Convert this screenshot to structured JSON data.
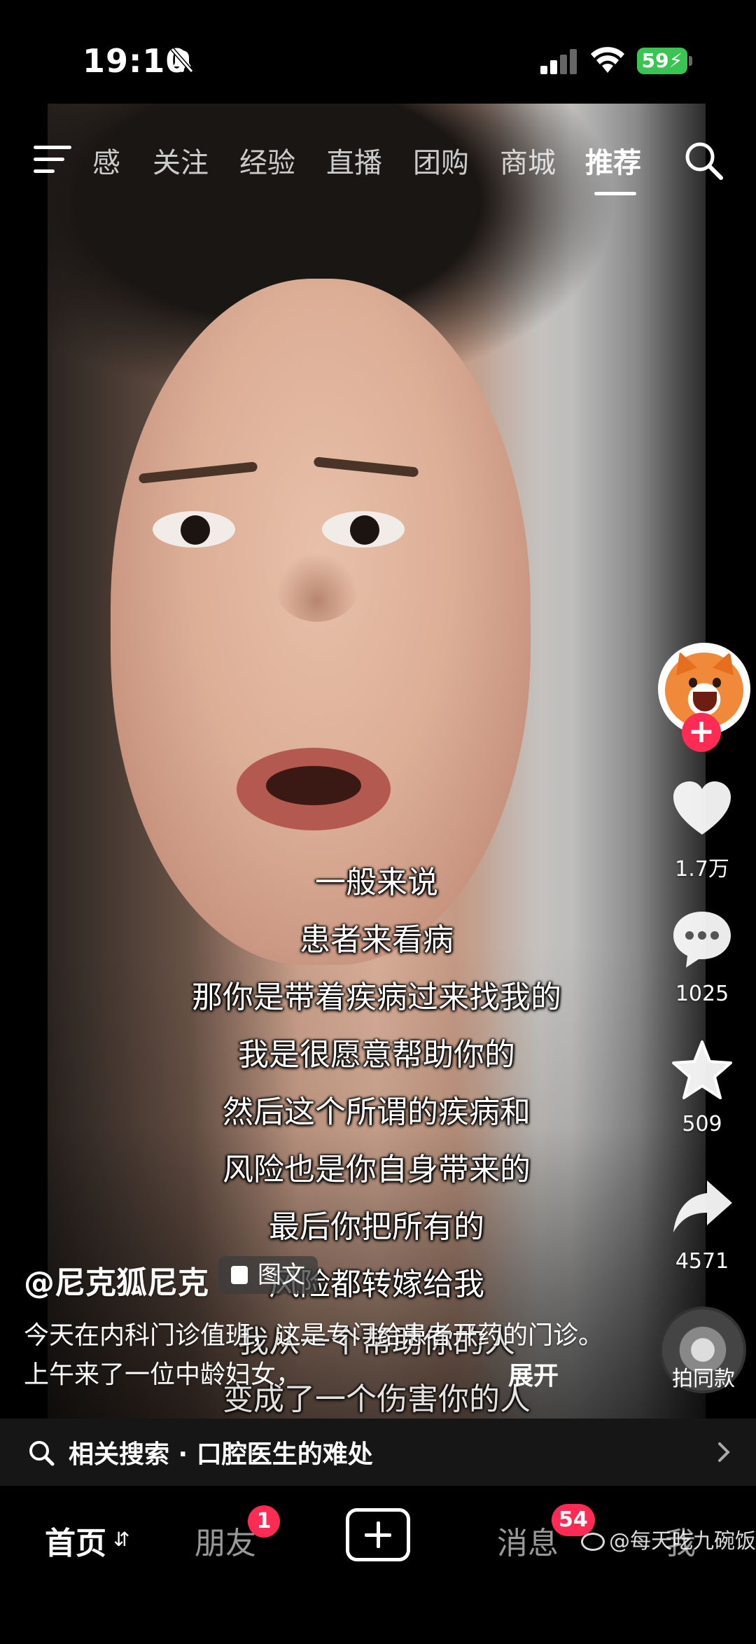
{
  "status_bar": {
    "time": "19:10",
    "battery": "59"
  },
  "top_tabs": {
    "items": [
      "感",
      "关注",
      "经验",
      "直播",
      "团购",
      "商城",
      "推荐"
    ],
    "active": "推荐"
  },
  "subtitles": [
    "一般来说",
    "患者来看病",
    "那你是带着疾病过来找我的",
    "我是很愿意帮助你的",
    "然后这个所谓的疾病和",
    "风险也是你自身带来的",
    "最后你把所有的",
    "风险都转嫁给我",
    "我从一个帮助你的人",
    "变成了一个伤害你的人"
  ],
  "actions": {
    "likes": "1.7万",
    "comments": "1025",
    "favorites": "509",
    "shares": "4571",
    "same_style": "拍同款"
  },
  "post": {
    "author": "@尼克狐尼克",
    "type_badge": "图文",
    "caption": "今天在内科门诊值班，这是专门给患者开药的门诊。上午来了一位中龄妇女，",
    "expand": "展开"
  },
  "related_search": {
    "label": "相关搜索 · 口腔医生的难处"
  },
  "bottom_nav": {
    "home": "首页",
    "friends": "朋友",
    "friends_badge": "1",
    "messages": "消息",
    "messages_badge": "54",
    "me": "我"
  },
  "watermark": "@每天吃九碗饭",
  "colors": {
    "accent": "#fe2c55",
    "battery": "#3ac553"
  }
}
